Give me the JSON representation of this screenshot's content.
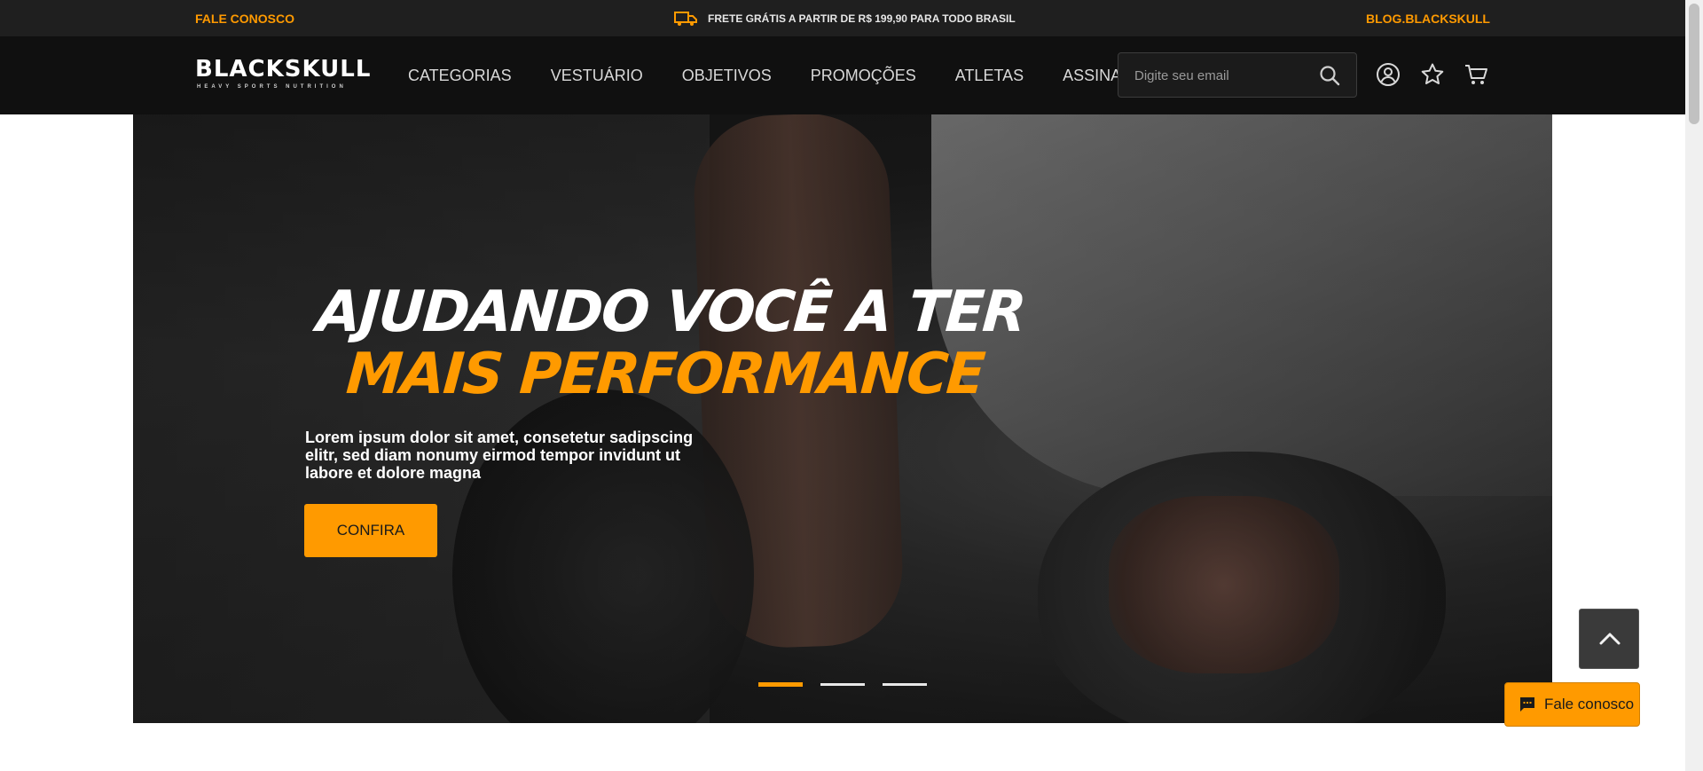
{
  "topbar": {
    "contact": "FALE CONOSCO",
    "shipping": "FRETE GRÁTIS A PARTIR DE R$ 199,90 PARA TODO BRASIL",
    "blog": "BLOG.BLACKSKULL",
    "truck_icon": "truck-icon"
  },
  "header": {
    "logo_text": "BLACKSKULL",
    "logo_tagline": "HEAVY SPORTS NUTRITION",
    "nav": [
      "CATEGORIAS",
      "VESTUÁRIO",
      "OBJETIVOS",
      "PROMOÇÕES",
      "ATLETAS",
      "ASSINATURA"
    ],
    "search_placeholder": "Digite seu email",
    "icons": [
      "search-icon",
      "user-icon",
      "star-icon",
      "cart-icon"
    ]
  },
  "hero": {
    "title_line1": "AJUDANDO VOCÊ A TER",
    "title_line2": "MAIS PERFORMANCE",
    "description": "Lorem ipsum dolor sit amet, consetetur sadipscing elitr, sed diam nonumy eirmod tempor invidunt ut labore et dolore magna",
    "cta_label": "CONFIRA",
    "slides": 3,
    "active_slide": 1
  },
  "floating": {
    "chat_label": "Fale conosco"
  },
  "colors": {
    "accent": "#ff9a00",
    "topbar_bg": "#1f1f1f",
    "header_bg": "#101010"
  }
}
